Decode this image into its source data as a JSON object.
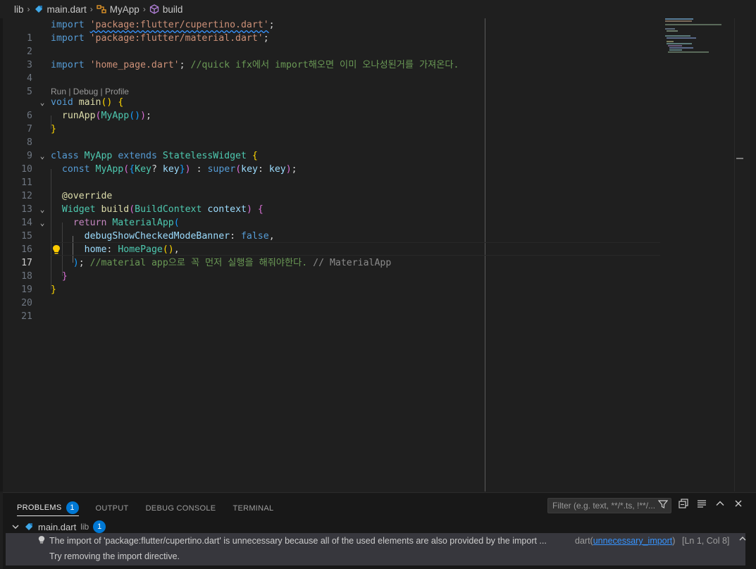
{
  "breadcrumb": {
    "folder": "lib",
    "file": "main.dart",
    "class": "MyApp",
    "method": "build"
  },
  "icons": {
    "dart_file": "dart-file-icon",
    "class_symbol": "class-symbol-icon",
    "method_symbol": "method-symbol-icon",
    "lightbulb": "lightbulb-icon"
  },
  "colors": {
    "keyword": "#569cd6",
    "control": "#c586c0",
    "string": "#ce9178",
    "comment": "#6a9955",
    "type": "#4ec9b0",
    "function": "#dcdcaa",
    "variable": "#9cdcfe",
    "accent": "#0078d4"
  },
  "editor": {
    "codelens": "Run | Debug | Profile",
    "lines": [
      {
        "n": "1",
        "text": "import 'package:flutter/cupertino.dart';"
      },
      {
        "n": "2",
        "text": "import 'package:flutter/material.dart';"
      },
      {
        "n": "3",
        "text": ""
      },
      {
        "n": "4",
        "text": "import 'home_page.dart'; //quick ifx에서 import해오면 이미 오나성된거를 가져온다."
      },
      {
        "n": "5",
        "text": ""
      },
      {
        "n": "6",
        "text": "void main() {"
      },
      {
        "n": "7",
        "text": "  runApp(MyApp());"
      },
      {
        "n": "8",
        "text": "}"
      },
      {
        "n": "9",
        "text": ""
      },
      {
        "n": "10",
        "text": "class MyApp extends StatelessWidget {"
      },
      {
        "n": "11",
        "text": "  const MyApp({Key? key}) : super(key: key);"
      },
      {
        "n": "12",
        "text": ""
      },
      {
        "n": "13",
        "text": "  @override"
      },
      {
        "n": "14",
        "text": "  Widget build(BuildContext context) {"
      },
      {
        "n": "15",
        "text": "    return MaterialApp("
      },
      {
        "n": "16",
        "text": "      debugShowCheckedModeBanner: false,"
      },
      {
        "n": "17",
        "text": "      home: HomePage(),"
      },
      {
        "n": "18",
        "text": "    ); //material app으로 꼭 먼저 실행을 해줘야한다. // MaterialApp"
      },
      {
        "n": "19",
        "text": "  }"
      },
      {
        "n": "20",
        "text": "}"
      },
      {
        "n": "21",
        "text": ""
      }
    ]
  },
  "panel": {
    "tabs": {
      "problems": "PROBLEMS",
      "problems_count": "1",
      "output": "OUTPUT",
      "debug_console": "DEBUG CONSOLE",
      "terminal": "TERMINAL"
    },
    "filter_placeholder": "Filter (e.g. text, **/*.ts, !**/...",
    "file_group": {
      "file": "main.dart",
      "folder": "lib",
      "count": "1"
    },
    "problem": {
      "message": "The import of 'package:flutter/cupertino.dart' is unnecessary because all of the used elements are also provided by the import ...",
      "source": "dart",
      "code": "unnecessary_import",
      "location": "[Ln 1, Col 8]",
      "hint": "Try removing the import directive."
    }
  }
}
